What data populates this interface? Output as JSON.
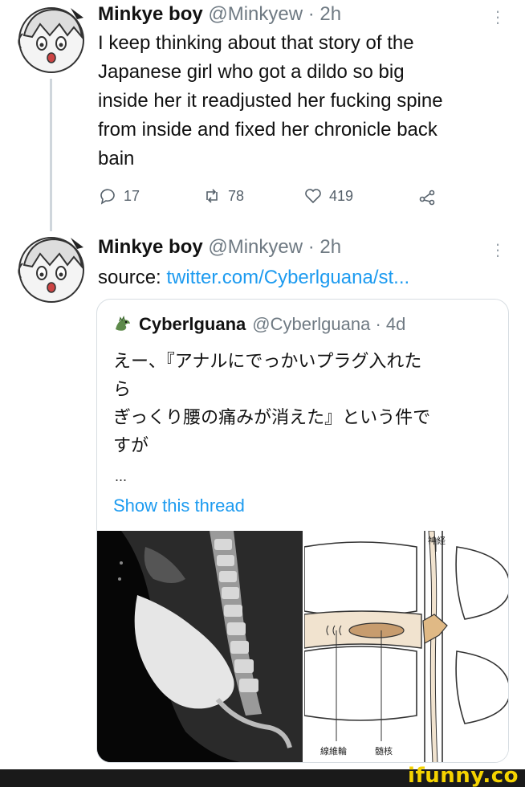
{
  "tweet1": {
    "name": "Minkye boy",
    "handle_time": " @Minkyew · 2h",
    "lines": [
      "I keep thinking about that story of the",
      "Japanese girl who got a dildo so big",
      "inside her it readjusted her fucking spine",
      "from inside and fixed her chronicle back",
      "bain"
    ],
    "replies": "17",
    "retweets": "78",
    "likes": "419"
  },
  "tweet2": {
    "name": "Minkye boy",
    "handle_time": " @Minkyew · 2h",
    "source_label": "source: ",
    "source_link": "twitter.com/Cyberlguana/st..."
  },
  "quote": {
    "name": "Cyberlguana",
    "handle_time": " @Cyberlguana · 4d",
    "lines": [
      "えー、『アナルにでっかいプラグ入れた",
      "ら",
      "ぎっくり腰の痛みが消えた』という件で",
      "すが"
    ],
    "ellipsis": "...",
    "show_thread": "Show this thread",
    "diagram_labels": {
      "nerve": "神経",
      "annulus": "線維輪",
      "nucleus": "髄核"
    }
  },
  "watermark": "ifunny.co",
  "colors": {
    "link": "#1d9bf0",
    "muted": "#6f7a83",
    "watermark": "#f5d300"
  },
  "icons": [
    "reply-icon",
    "retweet-icon",
    "like-icon",
    "share-icon",
    "more-icon",
    "avatar-icon"
  ]
}
